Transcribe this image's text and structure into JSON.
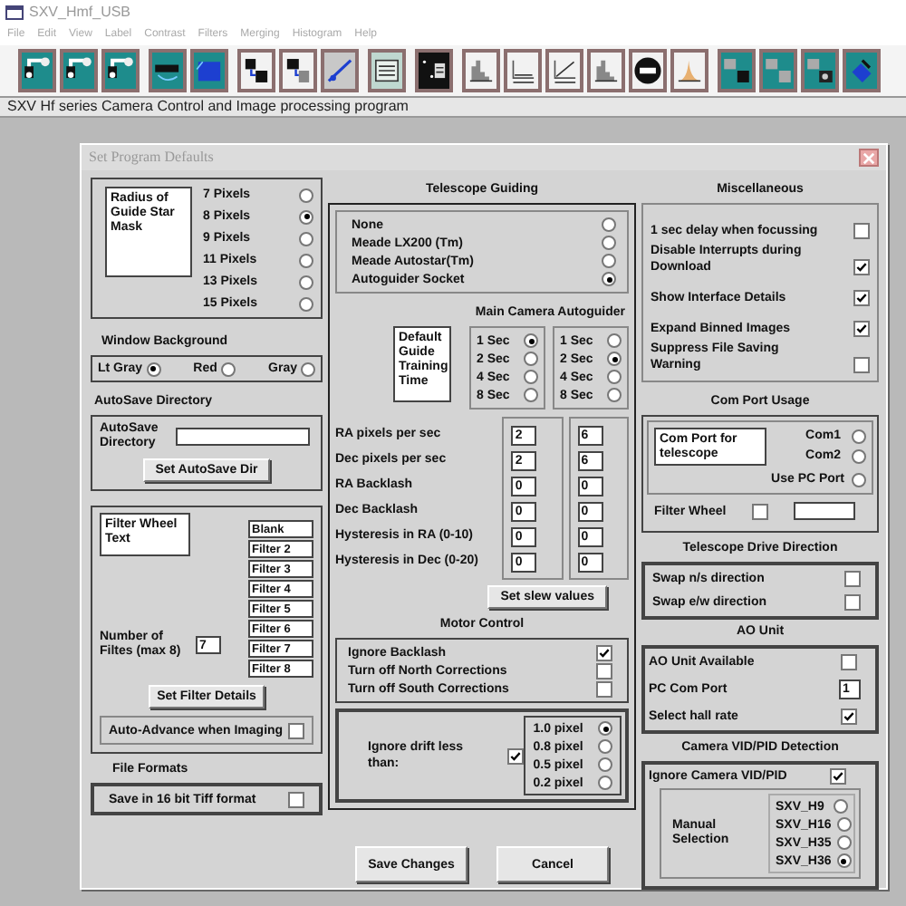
{
  "window": {
    "title": "SXV_Hmf_USB"
  },
  "menu": [
    "File",
    "Edit",
    "View",
    "Label",
    "Contrast",
    "Filters",
    "Merging",
    "Histogram",
    "Help"
  ],
  "status_text": "SXV Hf series Camera Control and Image processing program",
  "dialog": {
    "title": "Set Program Defaults",
    "guide_star_mask": {
      "label": "Radius of Guide Star Mask",
      "options": [
        {
          "label": "7 Pixels",
          "selected": false
        },
        {
          "label": "8 Pixels",
          "selected": true
        },
        {
          "label": "9 Pixels",
          "selected": false
        },
        {
          "label": "11 Pixels",
          "selected": false
        },
        {
          "label": "13 Pixels",
          "selected": false
        },
        {
          "label": "15 Pixels",
          "selected": false
        }
      ]
    },
    "window_background": {
      "heading": "Window Background",
      "options": [
        {
          "label": "Lt Gray",
          "selected": true
        },
        {
          "label": "Red",
          "selected": false
        },
        {
          "label": "Gray",
          "selected": false
        }
      ]
    },
    "autosave": {
      "heading": "AutoSave Directory",
      "label": "AutoSave Directory",
      "button": "Set AutoSave Dir"
    },
    "filter_wheel": {
      "text_label": "Filter Wheel Text",
      "count_label": "Number of Filtes (max 8)",
      "count": "7",
      "filters": [
        "Blank",
        "Filter 2",
        "Filter 3",
        "Filter 4",
        "Filter 5",
        "Filter 6",
        "Filter 7",
        "Filter 8"
      ],
      "button": "Set Filter Details",
      "auto_advance": {
        "label": "Auto-Advance when Imaging",
        "checked": false
      }
    },
    "file_formats": {
      "heading": "File Formats",
      "options": [
        {
          "label": "Save in 16 bit Tiff format",
          "checked": false
        }
      ]
    },
    "telescope_guiding": {
      "heading": "Telescope Guiding",
      "options": [
        {
          "label": "None",
          "selected": false
        },
        {
          "label": "Meade LX200 (Tm)",
          "selected": false
        },
        {
          "label": "Meade Autostar(Tm)",
          "selected": false
        },
        {
          "label": "Autoguider Socket",
          "selected": true
        }
      ]
    },
    "autoguider": {
      "heading": "Main Camera Autoguider",
      "label": "Default Guide Training Time",
      "main_times": [
        {
          "label": "1 Sec",
          "selected": true
        },
        {
          "label": "2 Sec",
          "selected": false
        },
        {
          "label": "4 Sec",
          "selected": false
        },
        {
          "label": "8 Sec",
          "selected": false
        }
      ],
      "autoguider_times": [
        {
          "label": "1 Sec",
          "selected": false
        },
        {
          "label": "2 Sec",
          "selected": true
        },
        {
          "label": "4 Sec",
          "selected": false
        },
        {
          "label": "8 Sec",
          "selected": false
        }
      ],
      "rows": [
        {
          "label": "RA pixels per sec",
          "main": "2",
          "autoguider": "6"
        },
        {
          "label": "Dec pixels per sec",
          "main": "2",
          "autoguider": "6"
        },
        {
          "label": "RA Backlash",
          "main": "0",
          "autoguider": "0"
        },
        {
          "label": "Dec Backlash",
          "main": "0",
          "autoguider": "0"
        },
        {
          "label": "Hysteresis in RA (0-10)",
          "main": "0",
          "autoguider": "0"
        },
        {
          "label": "Hysteresis in Dec (0-20)",
          "main": "0",
          "autoguider": "0"
        }
      ],
      "button": "Set slew values"
    },
    "motor_control": {
      "heading": "Motor Control",
      "options": [
        {
          "label": "Ignore Backlash",
          "checked": true
        },
        {
          "label": "Turn off North Corrections",
          "checked": false
        },
        {
          "label": "Turn off South Corrections",
          "checked": false
        }
      ],
      "drift": {
        "label": "Ignore drift less than:",
        "checked": true,
        "options": [
          {
            "label": "1.0 pixel",
            "selected": true
          },
          {
            "label": "0.8 pixel",
            "selected": false
          },
          {
            "label": "0.5 pixel",
            "selected": false
          },
          {
            "label": "0.2 pixel",
            "selected": false
          }
        ]
      }
    },
    "buttons": [
      "Save Changes",
      "Cancel"
    ],
    "miscellaneous": {
      "heading": "Miscellaneous",
      "options": [
        {
          "label": "1 sec delay when focussing",
          "checked": false
        },
        {
          "label": "Disable Interrupts during Download",
          "checked": true
        },
        {
          "label": "Show Interface Details",
          "checked": true
        },
        {
          "label": "Expand Binned Images",
          "checked": true
        },
        {
          "label": "Suppress File Saving Warning",
          "checked": false
        }
      ]
    },
    "com_port": {
      "heading": "Com Port Usage",
      "label": "Com Port for telescope",
      "options": [
        {
          "label": "Com1",
          "selected": false
        },
        {
          "label": "Com2",
          "selected": false
        },
        {
          "label": "Use PC Port",
          "selected": false
        }
      ],
      "filter_wheel": {
        "label": "Filter Wheel",
        "checked": false
      }
    },
    "drive_direction": {
      "heading": "Telescope Drive Direction",
      "options": [
        {
          "label": "Swap n/s direction",
          "checked": false
        },
        {
          "label": "Swap e/w direction",
          "checked": false
        }
      ]
    },
    "ao_unit": {
      "heading": "AO Unit",
      "available": {
        "label": "AO Unit Available",
        "checked": false
      },
      "port_label": "PC Com Port",
      "port": "1",
      "hall_rate": {
        "label": "Select hall rate",
        "checked": true
      }
    },
    "vid_pid": {
      "heading": "Camera VID/PID Detection",
      "ignore": {
        "label": "Ignore Camera VID/PID",
        "checked": true
      },
      "manual_label": "Manual Selection",
      "options": [
        {
          "label": "SXV_H9",
          "selected": false
        },
        {
          "label": "SXV_H16",
          "selected": false
        },
        {
          "label": "SXV_H35",
          "selected": false
        },
        {
          "label": "SXV_H36",
          "selected": true
        }
      ]
    }
  }
}
